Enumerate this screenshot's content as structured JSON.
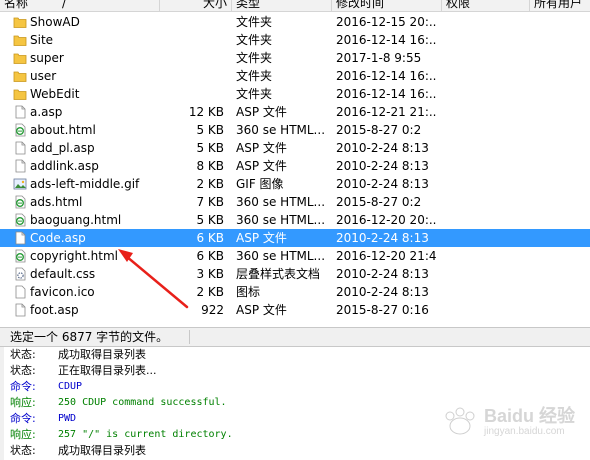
{
  "columns": {
    "name": "名称",
    "sort_indicator": "/",
    "size": "大小",
    "type": "类型",
    "modified": "修改时间",
    "perm": "权限",
    "owner": "所有用户"
  },
  "files": [
    {
      "name": "ShowAD",
      "size": "",
      "type": "文件夹",
      "modified": "2016-12-15 20:...",
      "icon": "folder-icon",
      "selected": false
    },
    {
      "name": "Site",
      "size": "",
      "type": "文件夹",
      "modified": "2016-12-14 16:...",
      "icon": "folder-icon",
      "selected": false
    },
    {
      "name": "super",
      "size": "",
      "type": "文件夹",
      "modified": "2017-1-8 9:55",
      "icon": "folder-icon",
      "selected": false
    },
    {
      "name": "user",
      "size": "",
      "type": "文件夹",
      "modified": "2016-12-14 16:...",
      "icon": "folder-icon",
      "selected": false
    },
    {
      "name": "WebEdit",
      "size": "",
      "type": "文件夹",
      "modified": "2016-12-14 16:...",
      "icon": "folder-icon",
      "selected": false
    },
    {
      "name": "a.asp",
      "size": "12 KB",
      "type": "ASP 文件",
      "modified": "2016-12-21 21:...",
      "icon": "file-icon",
      "selected": false
    },
    {
      "name": "about.html",
      "size": "5 KB",
      "type": "360 se HTML...",
      "modified": "2015-8-27 0:2",
      "icon": "html-file-icon",
      "selected": false
    },
    {
      "name": "add_pl.asp",
      "size": "5 KB",
      "type": "ASP 文件",
      "modified": "2010-2-24 8:13",
      "icon": "file-icon",
      "selected": false
    },
    {
      "name": "addlink.asp",
      "size": "8 KB",
      "type": "ASP 文件",
      "modified": "2010-2-24 8:13",
      "icon": "file-icon",
      "selected": false
    },
    {
      "name": "ads-left-middle.gif",
      "size": "2 KB",
      "type": "GIF 图像",
      "modified": "2010-2-24 8:13",
      "icon": "image-file-icon",
      "selected": false
    },
    {
      "name": "ads.html",
      "size": "7 KB",
      "type": "360 se HTML...",
      "modified": "2015-8-27 0:2",
      "icon": "html-file-icon",
      "selected": false
    },
    {
      "name": "baoguang.html",
      "size": "5 KB",
      "type": "360 se HTML...",
      "modified": "2016-12-20 20:...",
      "icon": "html-file-icon",
      "selected": false
    },
    {
      "name": "Code.asp",
      "size": "6 KB",
      "type": "ASP 文件",
      "modified": "2010-2-24 8:13",
      "icon": "file-icon",
      "selected": true
    },
    {
      "name": "copyright.html",
      "size": "6 KB",
      "type": "360 se HTML...",
      "modified": "2016-12-20 21:4",
      "icon": "html-file-icon",
      "selected": false
    },
    {
      "name": "default.css",
      "size": "3 KB",
      "type": "层叠样式表文档",
      "modified": "2010-2-24 8:13",
      "icon": "css-file-icon",
      "selected": false
    },
    {
      "name": "favicon.ico",
      "size": "2 KB",
      "type": "图标",
      "modified": "2010-2-24 8:13",
      "icon": "blank-file-icon",
      "selected": false
    },
    {
      "name": "foot.asp",
      "size": "922",
      "type": "ASP 文件",
      "modified": "2015-8-27 0:16",
      "icon": "file-icon",
      "selected": false
    }
  ],
  "statusbar": {
    "text": "选定一个 6877 字节的文件。"
  },
  "log": [
    {
      "label": "状态:",
      "msg": "成功取得目录列表",
      "kind": "st",
      "mono": false
    },
    {
      "label": "状态:",
      "msg": "正在取得目录列表...",
      "kind": "st",
      "mono": false
    },
    {
      "label": "命令:",
      "msg": "CDUP",
      "kind": "cmd",
      "mono": true
    },
    {
      "label": "响应:",
      "msg": "250 CDUP command successful.",
      "kind": "resp",
      "mono": true
    },
    {
      "label": "命令:",
      "msg": "PWD",
      "kind": "cmd",
      "mono": true
    },
    {
      "label": "响应:",
      "msg": "257 \"/\" is current directory.",
      "kind": "resp",
      "mono": true
    },
    {
      "label": "状态:",
      "msg": "成功取得目录列表",
      "kind": "st",
      "mono": false
    }
  ],
  "watermark": {
    "text": "Baidu 经验",
    "sub": "jingyan.baidu.com"
  },
  "colors": {
    "selection": "#3399ff",
    "arrow": "#e8201a",
    "folder": "#f5c542"
  }
}
